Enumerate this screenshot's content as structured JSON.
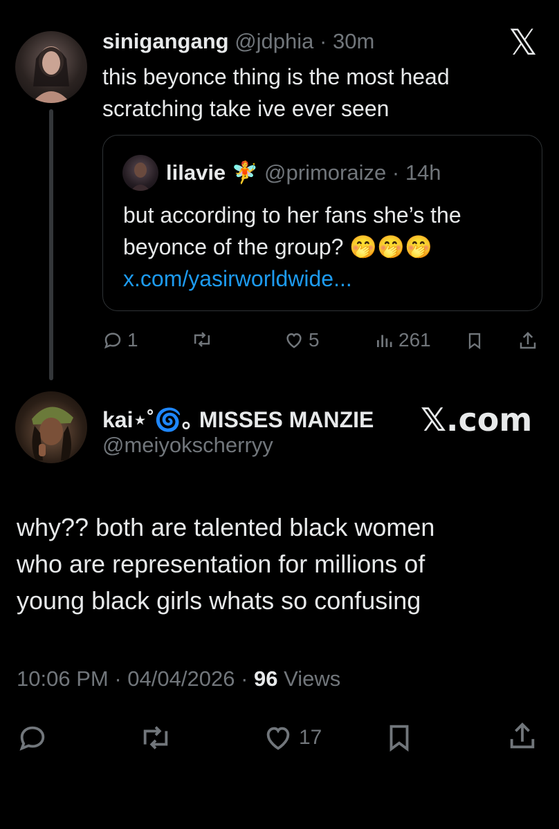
{
  "first_post": {
    "display_name": "sinigangang",
    "handle": "@jdphia",
    "separator": "·",
    "time": "30m",
    "text_line1": "this beyonce thing is the most head",
    "text_line2": "scratching take ive ever seen",
    "quote": {
      "display_name": "lilavie",
      "name_emoji": "🧚",
      "handle": "@primoraize",
      "separator": "·",
      "time": "14h",
      "text_line1": "but according to her fans she’s the",
      "text_line2": "beyonce of the group? 🤭🤭🤭",
      "link": "x.com/yasirworldwide..."
    },
    "actions": {
      "replies": "1",
      "likes": "5",
      "views": "261"
    }
  },
  "reply_post": {
    "display_name": "kai⋆˚🌀｡ MISSES MANZIE",
    "handle": "@meiyokscherryy",
    "watermark": "𝕏.com",
    "text_line1": "why?? both are talented black women",
    "text_line2": "who are representation for millions of",
    "text_line3": "young black girls whats so confusing",
    "meta": {
      "time": "10:06 PM",
      "separator1": "·",
      "date": "04/04/2026",
      "separator2": "·",
      "views_count": "96",
      "views_label": "Views"
    },
    "actions": {
      "likes": "17"
    }
  },
  "logo": "𝕏",
  "colors": {
    "background": "#000000",
    "text": "#e7e9ea",
    "secondary": "#71767b",
    "link": "#1d9bf0",
    "border": "#2f3336"
  }
}
